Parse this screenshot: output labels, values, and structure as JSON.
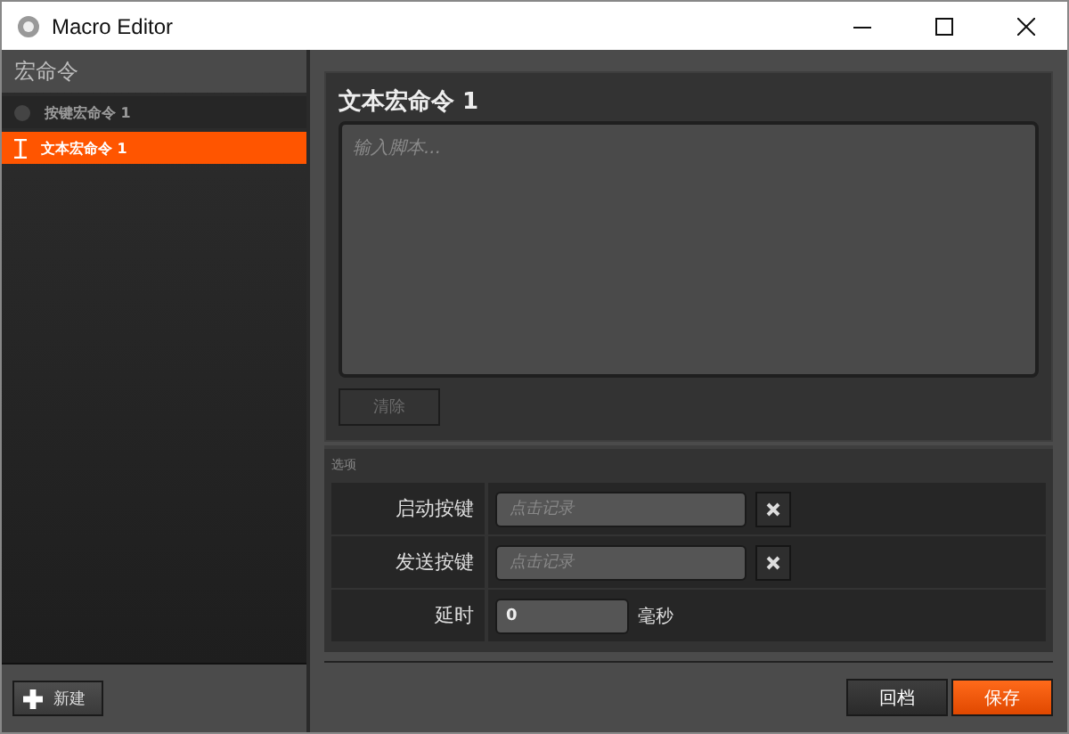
{
  "window": {
    "title": "Macro Editor"
  },
  "sidebar": {
    "title": "宏命令",
    "items": [
      {
        "label": "按键宏命令 1",
        "kind": "key",
        "selected": false
      },
      {
        "label": "文本宏命令 1",
        "kind": "text",
        "selected": true
      }
    ],
    "new_button": "新建"
  },
  "editor": {
    "title": "文本宏命令 1",
    "placeholder": "输入脚本...",
    "clear_button": {
      "label": "清除",
      "disabled": true
    }
  },
  "options": {
    "title": "选项",
    "rows": [
      {
        "kind": "key",
        "label": "启动按键",
        "placeholder": "点击记录"
      },
      {
        "kind": "key",
        "label": "发送按键",
        "placeholder": "点击记录"
      },
      {
        "kind": "number",
        "label": "延时",
        "value": "0",
        "unit": "毫秒"
      }
    ]
  },
  "footer": {
    "buttons": [
      {
        "label": "回档",
        "primary": false
      },
      {
        "label": "保存",
        "primary": true
      }
    ]
  }
}
